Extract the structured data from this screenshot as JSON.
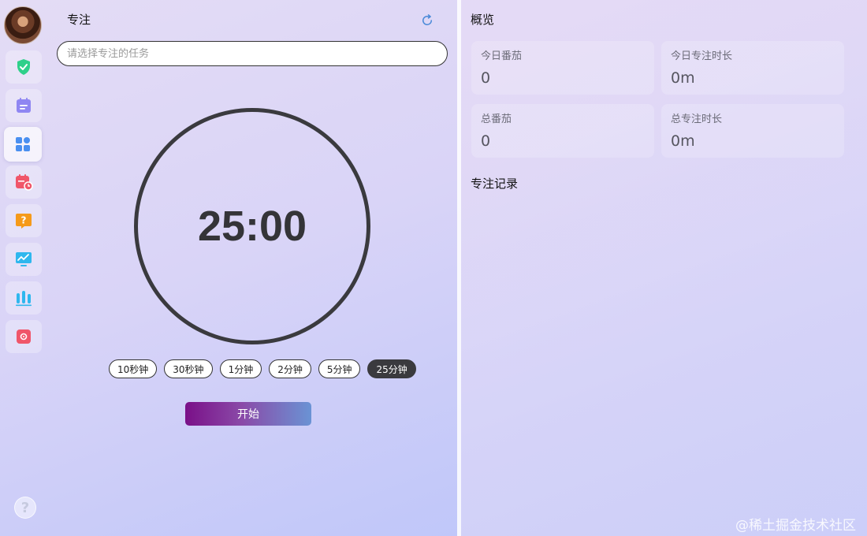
{
  "sidebar": {
    "items": [
      {
        "icon": "shield-check-icon",
        "color": "#2fd08a"
      },
      {
        "icon": "calendar-note-icon",
        "color": "#8f86f2"
      },
      {
        "icon": "apps-grid-icon",
        "color": "#4a8ff0",
        "active": true
      },
      {
        "icon": "calendar-clock-icon",
        "color": "#f0566a"
      },
      {
        "icon": "question-chat-icon",
        "color": "#f59a1a"
      },
      {
        "icon": "monitor-chart-icon",
        "color": "#2fb7ee"
      },
      {
        "icon": "bar-stats-icon",
        "color": "#2fb7ee"
      },
      {
        "icon": "flower-badge-icon",
        "color": "#f0566a"
      }
    ],
    "help_label": "?"
  },
  "focus": {
    "title": "专注",
    "task_placeholder": "请选择专注的任务",
    "timer": "25:00",
    "presets": [
      "10秒钟",
      "30秒钟",
      "1分钟",
      "2分钟",
      "5分钟",
      "25分钟"
    ],
    "active_preset": "25分钟",
    "start_label": "开始"
  },
  "overview": {
    "title": "概览",
    "stats": [
      {
        "label": "今日番茄",
        "value": "0"
      },
      {
        "label": "今日专注时长",
        "value": "0m"
      },
      {
        "label": "总番茄",
        "value": "0"
      },
      {
        "label": "总专注时长",
        "value": "0m"
      }
    ],
    "records_title": "专注记录"
  },
  "watermark": "@稀土掘金技术社区",
  "colors": {
    "accent_dark": "#3a3a3e",
    "start_gradient_from": "#7a1088",
    "start_gradient_to": "#6a93d4"
  }
}
